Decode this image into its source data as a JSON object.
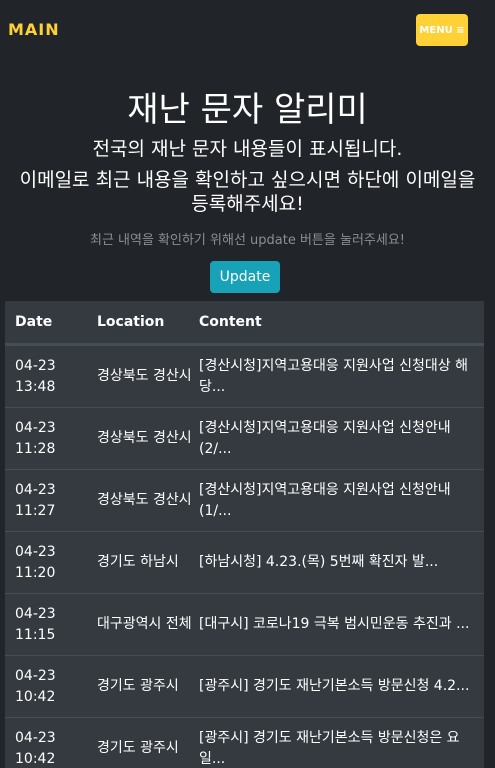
{
  "nav": {
    "brand": "MAIN",
    "menu_label": "MENU ≡"
  },
  "hero": {
    "title": "재난 문자 알리미",
    "subtitle1": "전국의 재난 문자 내용들이 표시됩니다.",
    "subtitle2": "이메일로 최근 내용을 확인하고 싶으시면 하단에 이메일을 등록해주세요!",
    "hint": "최근 내역을 확인하기 위해선 update 버튼을 눌러주세요!",
    "update_label": "Update"
  },
  "table": {
    "headers": [
      "Date",
      "Location",
      "Content"
    ],
    "rows": [
      {
        "date": "04-23 13:48",
        "location": "경상북도 경산시",
        "content": "[경산시청]지역고용대응 지원사업 신청대상 해당..."
      },
      {
        "date": "04-23 11:28",
        "location": "경상북도 경산시",
        "content": "[경산시청]지역고용대응 지원사업 신청안내(2/..."
      },
      {
        "date": "04-23 11:27",
        "location": "경상북도 경산시",
        "content": "[경산시청]지역고용대응 지원사업 신청안내(1/..."
      },
      {
        "date": "04-23 11:20",
        "location": "경기도 하남시",
        "content": "[하남시청] 4.23.(목) 5번째 확진자 발..."
      },
      {
        "date": "04-23 11:15",
        "location": "대구광역시 전체",
        "content": "[대구시] 코로나19 극복 범시민운동 추진과 ..."
      },
      {
        "date": "04-23 10:42",
        "location": "경기도 광주시",
        "content": "[광주시] 경기도 재난기본소득 방문신청 4.2..."
      },
      {
        "date": "04-23 10:42",
        "location": "경기도 광주시",
        "content": "[광주시] 경기도 재난기본소득 방문신청은 요일..."
      }
    ]
  }
}
